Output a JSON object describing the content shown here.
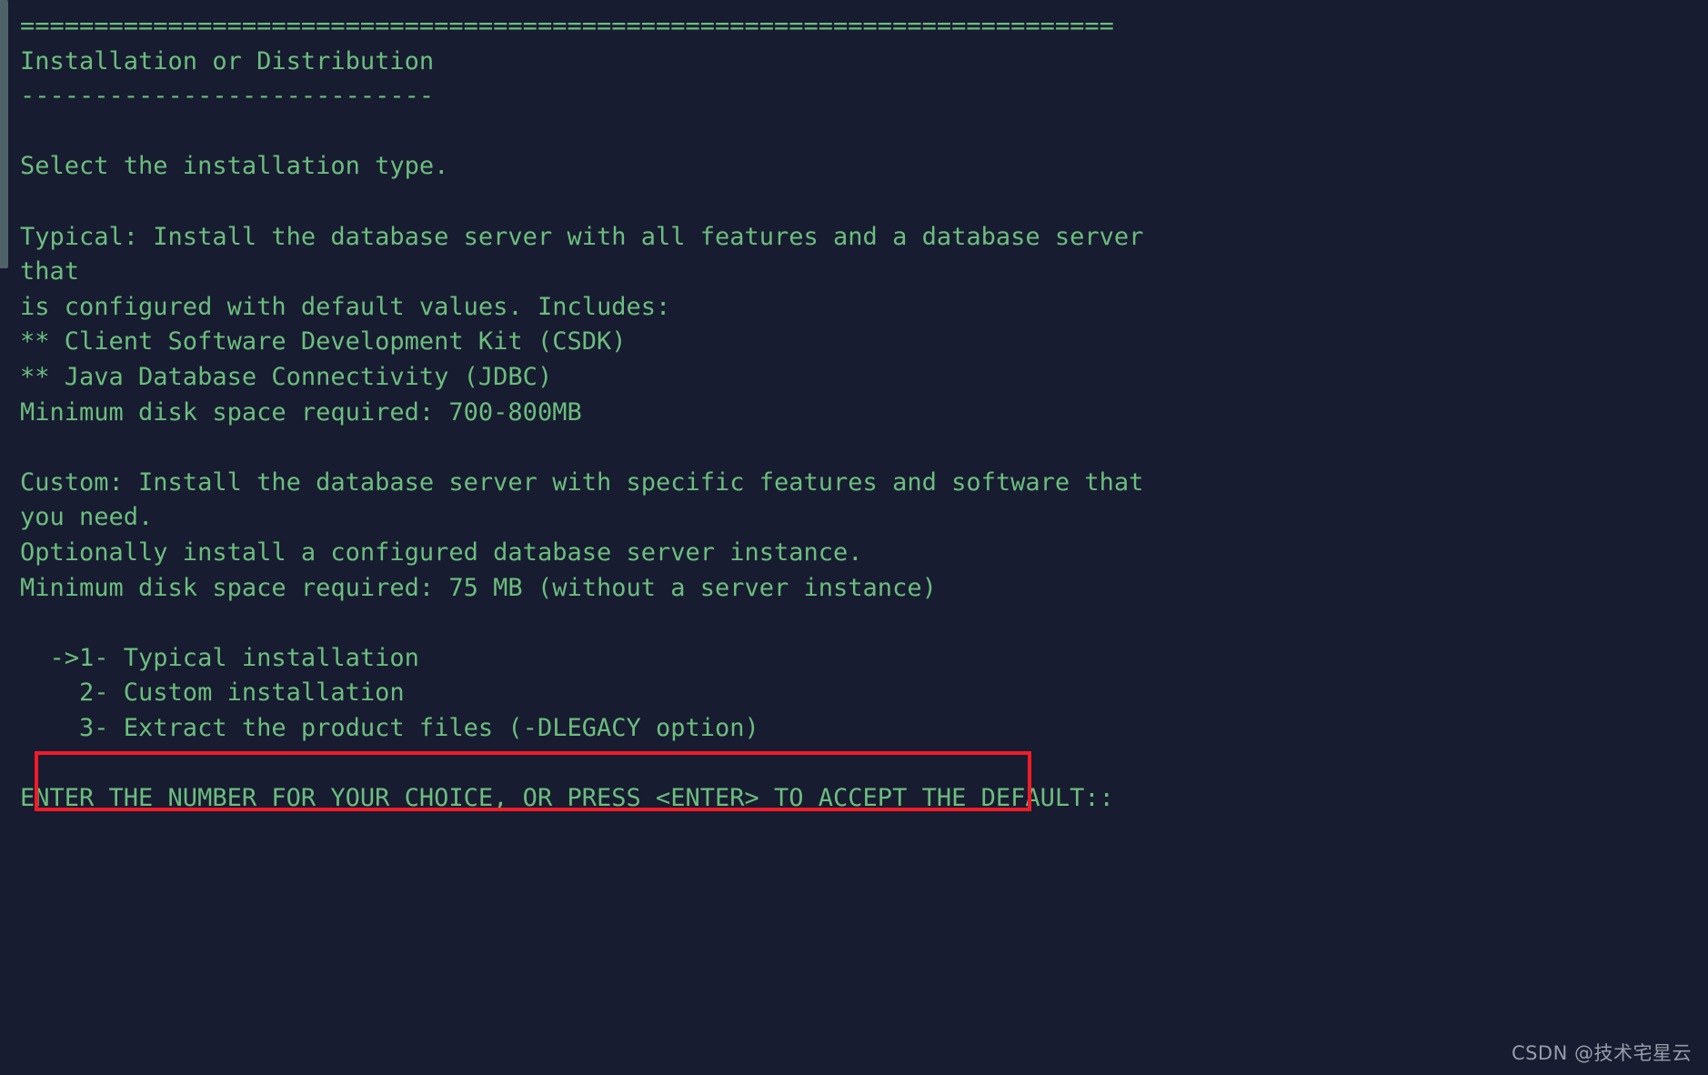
{
  "terminal": {
    "background_color": "#171c30",
    "text_color": "#6cbd7e",
    "scrollbar_color": "#4e6269",
    "highlight_color": "#f31b27",
    "lines": [
      "==========================================================================",
      "Installation or Distribution",
      "----------------------------",
      "",
      "Select the installation type.",
      "",
      "Typical: Install the database server with all features and a database server",
      "that",
      "is configured with default values. Includes:",
      "** Client Software Development Kit (CSDK)",
      "** Java Database Connectivity (JDBC)",
      "Minimum disk space required: 700-800MB",
      "",
      "Custom: Install the database server with specific features and software that",
      "you need.",
      "Optionally install a configured database server instance.",
      "Minimum disk space required: 75 MB (without a server instance)",
      "",
      "  ->1- Typical installation",
      "    2- Custom installation",
      "    3- Extract the product files (-DLEGACY option)",
      "",
      "ENTER THE NUMBER FOR YOUR CHOICE, OR PRESS <ENTER> TO ACCEPT THE DEFAULT::"
    ],
    "header_title": "Installation or Distribution",
    "prompt": "ENTER THE NUMBER FOR YOUR CHOICE, OR PRESS <ENTER> TO ACCEPT THE DEFAULT::",
    "selected_option": "->1- Typical installation",
    "menu_options": [
      {
        "number": "1",
        "label": "Typical installation",
        "marker": "->",
        "selected": true
      },
      {
        "number": "2",
        "label": "Custom installation",
        "marker": "",
        "selected": false
      },
      {
        "number": "3",
        "label": "Extract the product files (-DLEGACY option)",
        "marker": "",
        "selected": false
      }
    ]
  },
  "watermark": {
    "text": "CSDN @技术宅星云"
  }
}
